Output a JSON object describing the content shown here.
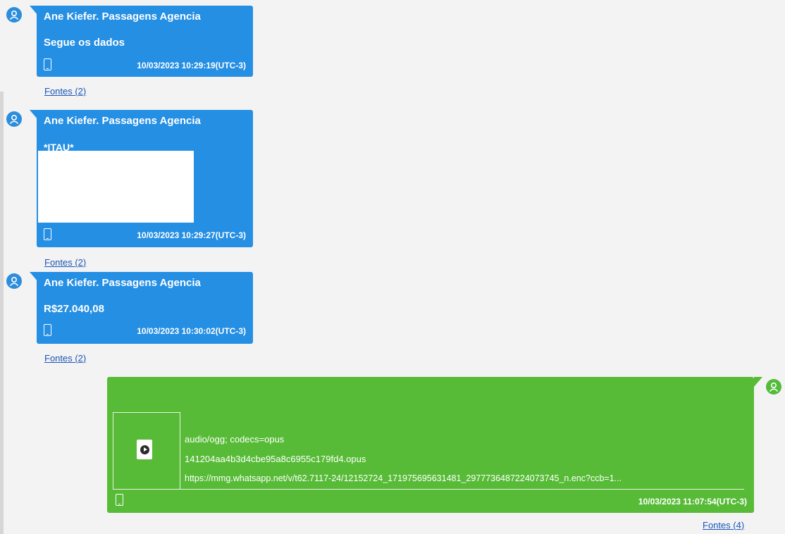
{
  "colors": {
    "incoming_bubble": "#258fe4",
    "outgoing_bubble": "#57bb37",
    "link": "#1a56b8",
    "background": "#f3f3f3"
  },
  "messages": [
    {
      "direction": "incoming",
      "sender": "Ane Kiefer. Passagens Agencia",
      "text": "Segue os dados",
      "timestamp": "10/03/2023 10:29:19(UTC-3)",
      "device_icon": "phone-icon",
      "sources_link": "Fontes (2)"
    },
    {
      "direction": "incoming",
      "sender": "Ane Kiefer. Passagens Agencia",
      "text": "*ITAU*",
      "redacted": true,
      "timestamp": "10/03/2023 10:29:27(UTC-3)",
      "device_icon": "phone-icon",
      "sources_link": "Fontes (2)"
    },
    {
      "direction": "incoming",
      "sender": "Ane Kiefer. Passagens Agencia",
      "text": "R$27.040,08",
      "timestamp": "10/03/2023 10:30:02(UTC-3)",
      "device_icon": "phone-icon",
      "sources_link": "Fontes (2)"
    },
    {
      "direction": "outgoing",
      "attachment": {
        "icon": "audio-file-icon",
        "mime": "audio/ogg; codecs=opus",
        "filename": "141204aa4b3d4cbe95a8c6955c179fd4.opus",
        "url": "https://mmg.whatsapp.net/v/t62.7117-24/12152724_171975695631481_2977736487224073745_n.enc?ccb=1..."
      },
      "timestamp": "10/03/2023 11:07:54(UTC-3)",
      "device_icon": "phone-icon",
      "sources_link": "Fontes (4)"
    }
  ]
}
